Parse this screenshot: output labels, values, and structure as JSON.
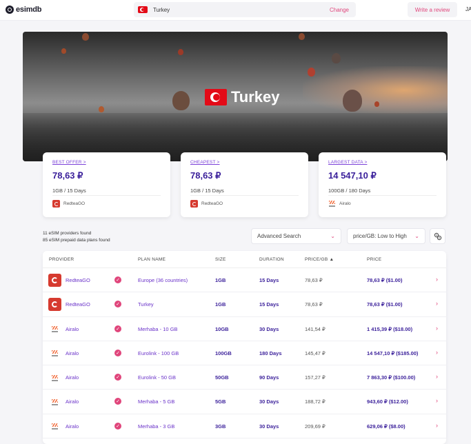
{
  "header": {
    "logo_text": "esimdb",
    "search_country": "Turkey",
    "change_label": "Change",
    "review_label": "Write a review",
    "lang_label": "JA"
  },
  "hero": {
    "title": "Turkey"
  },
  "cards": [
    {
      "label": "BEST OFFER >",
      "price": "78,63 ₽",
      "sub": "1GB / 15 Days",
      "provider": "RedteaGO",
      "provider_icon": "redteago-logo"
    },
    {
      "label": "CHEAPEST >",
      "price": "78,63 ₽",
      "sub": "1GB / 15 Days",
      "provider": "RedteaGO",
      "provider_icon": "redteago-logo"
    },
    {
      "label": "LARGEST DATA >",
      "price": "14 547,10 ₽",
      "sub": "100GB / 180 Days",
      "provider": "Airalo",
      "provider_icon": "airalo-logo"
    }
  ],
  "counts": {
    "providers": "11 eSIM providers found",
    "plans": "85 eSIM prepaid data plans found"
  },
  "filters": {
    "advanced_search": "Advanced Search",
    "sort": "price/GB: Low to High"
  },
  "table": {
    "headers": {
      "provider": "PROVIDER",
      "plan": "PLAN NAME",
      "size": "SIZE",
      "duration": "DURATION",
      "price_gb": "PRICE/GB ▲",
      "price": "PRICE"
    },
    "rows": [
      {
        "provider": "RedteaGO",
        "plan": "Europe (36 countries)",
        "size": "1GB",
        "duration": "15 Days",
        "price_gb": "78,63 ₽",
        "price": "78,63 ₽ ($1.00)"
      },
      {
        "provider": "RedteaGO",
        "plan": "Turkey",
        "size": "1GB",
        "duration": "15 Days",
        "price_gb": "78,63 ₽",
        "price": "78,63 ₽ ($1.00)"
      },
      {
        "provider": "Airalo",
        "plan": "Merhaba - 10 GB",
        "size": "10GB",
        "duration": "30 Days",
        "price_gb": "141,54 ₽",
        "price": "1 415,39 ₽ ($18.00)"
      },
      {
        "provider": "Airalo",
        "plan": "Eurolink - 100 GB",
        "size": "100GB",
        "duration": "180 Days",
        "price_gb": "145,47 ₽",
        "price": "14 547,10 ₽ ($185.00)"
      },
      {
        "provider": "Airalo",
        "plan": "Eurolink - 50 GB",
        "size": "50GB",
        "duration": "90 Days",
        "price_gb": "157,27 ₽",
        "price": "7 863,30 ₽ ($100.00)"
      },
      {
        "provider": "Airalo",
        "plan": "Merhaba - 5 GB",
        "size": "5GB",
        "duration": "30 Days",
        "price_gb": "188,72 ₽",
        "price": "943,60 ₽ ($12.00)"
      },
      {
        "provider": "Airalo",
        "plan": "Merhaba - 3 GB",
        "size": "3GB",
        "duration": "30 Days",
        "price_gb": "209,69 ₽",
        "price": "629,06 ₽ ($8.00)"
      }
    ]
  }
}
